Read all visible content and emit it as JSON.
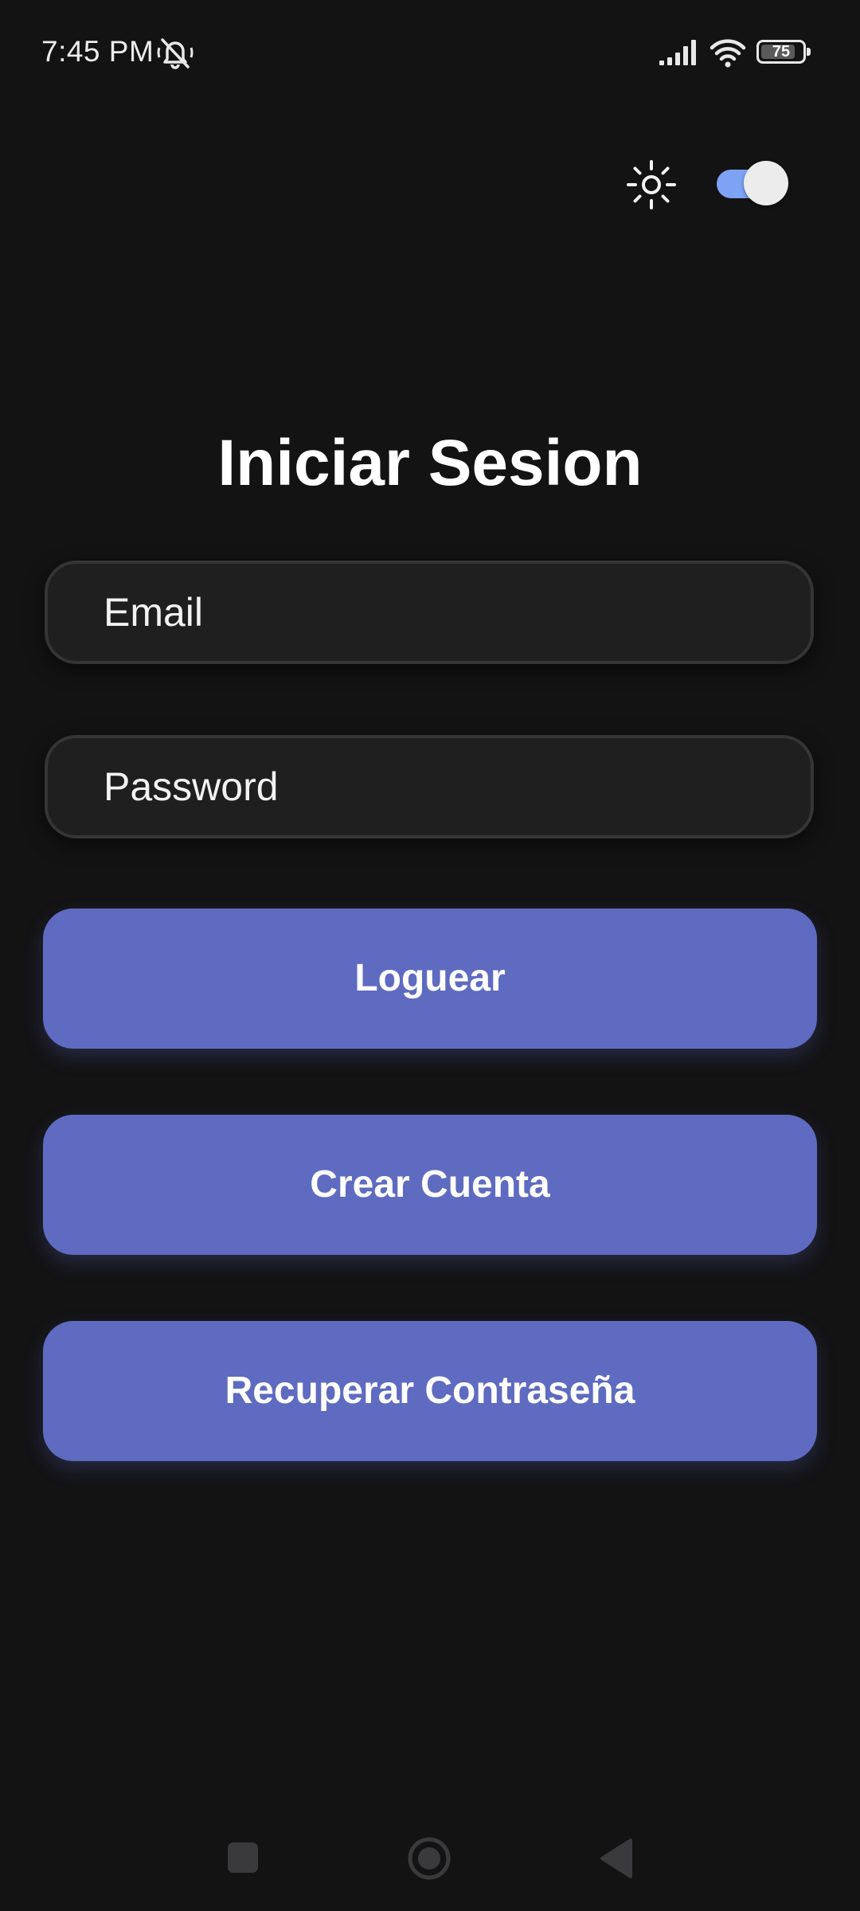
{
  "status_bar": {
    "time": "7:45 PM",
    "battery_level": "75",
    "icons": [
      "mute-icon",
      "signal-icon",
      "wifi-icon",
      "battery-icon"
    ]
  },
  "theme_controls": {
    "icon": "sun-icon",
    "toggle_on": true
  },
  "title": "Iniciar Sesion",
  "form": {
    "email_placeholder": "Email",
    "password_placeholder": "Password"
  },
  "buttons": {
    "login": "Loguear",
    "create_account": "Crear Cuenta",
    "recover_password": "Recuperar Contraseña"
  },
  "navigation": {
    "icons": [
      "recents-icon",
      "home-icon",
      "back-icon"
    ]
  },
  "colors": {
    "background": "#131314",
    "button": "#5e6bc0",
    "toggle_track": "#7ea2f4",
    "input_background": "#1f1f20"
  }
}
